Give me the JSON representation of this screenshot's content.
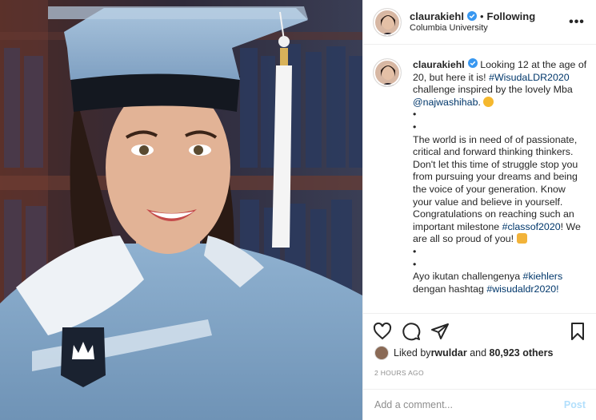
{
  "header": {
    "username": "claurakiehl",
    "separator": "•",
    "follow_status": "Following",
    "location": "Columbia University",
    "more_label": "•••"
  },
  "caption": {
    "username": "claurakiehl",
    "line1": " Looking 12 at the age of 20, but here it is! ",
    "hashtag1": "#WisudaLDR2020",
    "line2": " challenge inspired by the lovely Mba ",
    "mention": "@najwashihab",
    "line3": ". ",
    "bullet": "•",
    "para": "The world is in need of of passionate, critical and forward thinking thinkers. Don't let this time of struggle stop you from pursuing your dreams and being the voice of your generation. Know your value and believe in yourself. Congratulations on reaching such an important milestone ",
    "hashtag2": "#classof2020",
    "para_end": "! We are all so proud of you! ",
    "line_ayo": "Ayo ikutan challengenya ",
    "hashtag3": "#kiehlers",
    "line_cut": "dengan hashtag ",
    "hashtag4": "#wisudaldr2020!"
  },
  "likes": {
    "prefix": "Liked by ",
    "user": "rwuldar",
    "middle": " and ",
    "count": "80,923 others"
  },
  "timestamp": "2 HOURS AGO",
  "comment_box": {
    "placeholder": "Add a comment...",
    "post_label": "Post"
  },
  "icons": {
    "like": "heart-icon",
    "comment": "comment-icon",
    "share": "share-icon",
    "save": "bookmark-icon",
    "verified": "verified-badge-icon"
  },
  "colors": {
    "link": "#00376b",
    "verified": "#3897f0",
    "post_disabled": "#b2dffc",
    "muted": "#8e8e8e"
  }
}
